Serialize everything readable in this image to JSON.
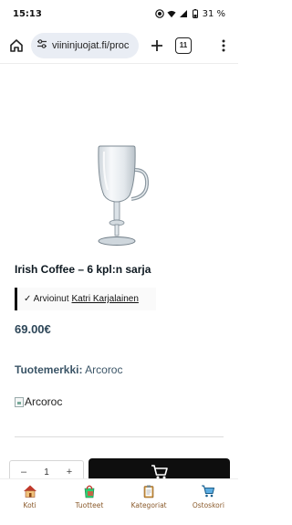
{
  "status_bar": {
    "time": "15:13",
    "battery": "31 %"
  },
  "browser": {
    "url": "viininjuojat.fi/proc",
    "tab_count": "11"
  },
  "product": {
    "title": "Irish Coffee – 6 kpl:n sarja",
    "review_prefix": "✓ Arvioinut",
    "reviewer": "Katri Karjalainen",
    "price": "69.00€",
    "brand_label": "Tuotemerkki:",
    "brand_name": "Arcoroc",
    "brand_image_alt": "Arcoroc"
  },
  "purchase": {
    "minus": "–",
    "quantity": "1",
    "plus": "+"
  },
  "bottom_nav": {
    "items": [
      {
        "label": "Koti",
        "icon": "home-icon"
      },
      {
        "label": "Tuotteet",
        "icon": "shopping-bag-icon"
      },
      {
        "label": "Kategoriat",
        "icon": "clipboard-icon"
      },
      {
        "label": "Ostoskori",
        "icon": "cart-icon"
      }
    ]
  }
}
